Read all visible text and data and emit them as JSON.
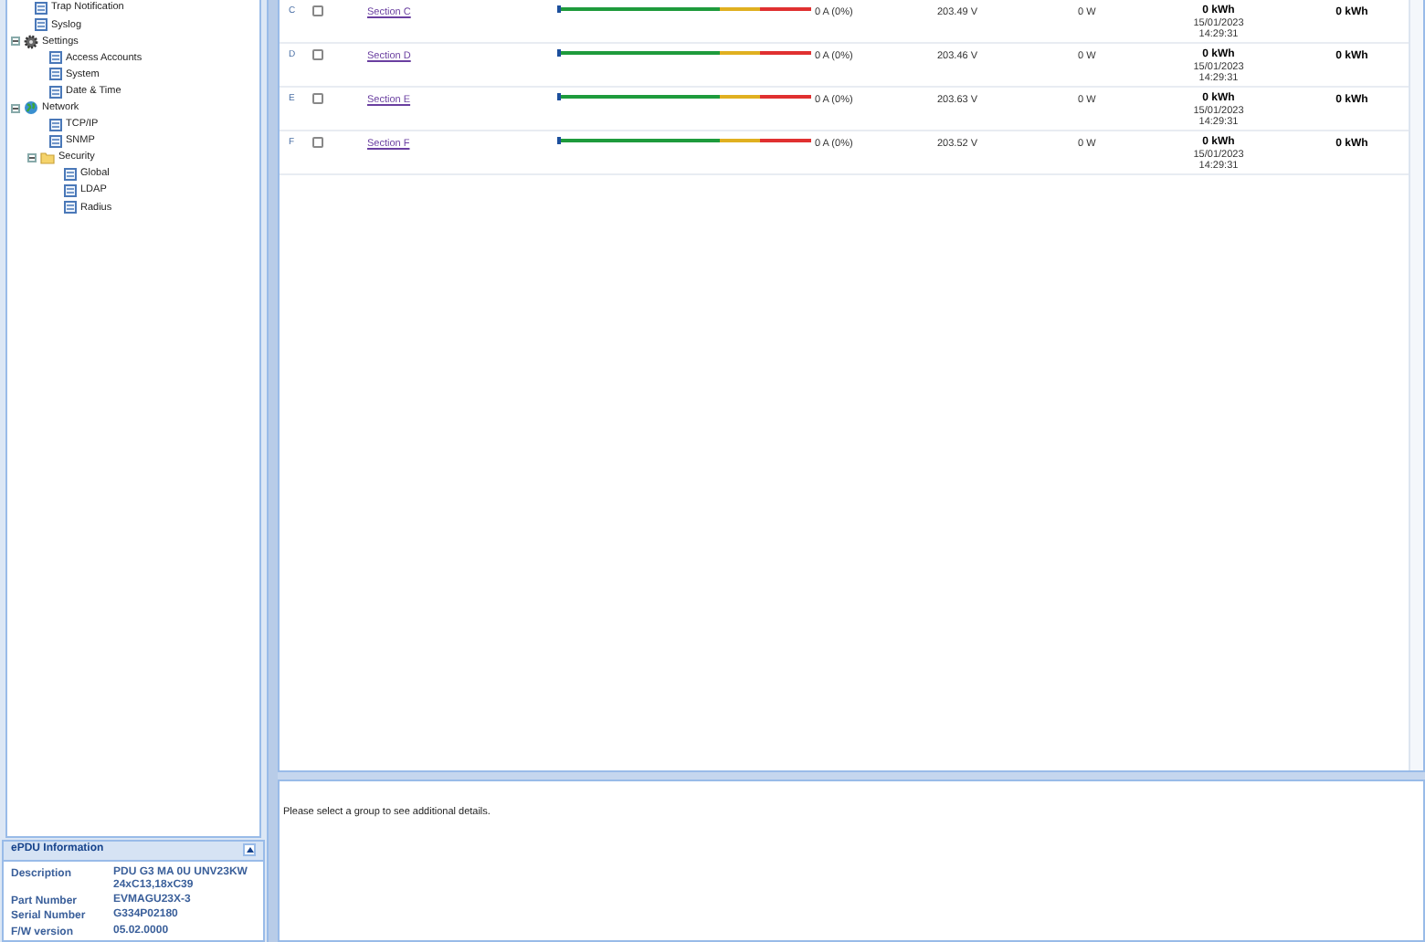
{
  "tree": [
    {
      "label": "Trap Notification",
      "kind": "page"
    },
    {
      "label": "Syslog",
      "kind": "page"
    },
    {
      "label": "Settings",
      "kind": "gear",
      "expanded": true,
      "children": [
        {
          "label": "Access Accounts",
          "kind": "page"
        },
        {
          "label": "System",
          "kind": "page"
        },
        {
          "label": "Date & Time",
          "kind": "page"
        }
      ]
    },
    {
      "label": "Network",
      "kind": "globe",
      "expanded": true,
      "children": [
        {
          "label": "TCP/IP",
          "kind": "page"
        },
        {
          "label": "SNMP",
          "kind": "page"
        },
        {
          "label": "Security",
          "kind": "folder",
          "expanded": true,
          "children": [
            {
              "label": "Global",
              "kind": "page"
            },
            {
              "label": "LDAP",
              "kind": "page"
            },
            {
              "label": "Radius",
              "kind": "page"
            }
          ]
        }
      ]
    }
  ],
  "info": {
    "title": "ePDU Information",
    "rows": [
      {
        "label": "Description",
        "value": [
          "PDU G3 MA 0U UNV23KW",
          "24xC13,18xC39"
        ]
      },
      {
        "label": "Part Number",
        "value": [
          "EVMAGU23X-3"
        ]
      },
      {
        "label": "Serial Number",
        "value": [
          "G334P02180"
        ]
      },
      {
        "label": "F/W version",
        "value": [
          "05.02.0000"
        ]
      }
    ]
  },
  "sections": [
    {
      "letter": "C",
      "checked": false,
      "name": "Section C",
      "level": 0,
      "current": "0 A (0%)",
      "voltage": "203.49 V",
      "power": "0 W",
      "energy": "0 kWh",
      "date": "15/01/2023",
      "time": "14:29:31",
      "total": "0 kWh"
    },
    {
      "letter": "D",
      "checked": false,
      "name": "Section D",
      "level": 0,
      "current": "0 A (0%)",
      "voltage": "203.46 V",
      "power": "0 W",
      "energy": "0 kWh",
      "date": "15/01/2023",
      "time": "14:29:31",
      "total": "0 kWh"
    },
    {
      "letter": "E",
      "checked": false,
      "name": "Section E",
      "level": 0,
      "current": "0 A (0%)",
      "voltage": "203.63 V",
      "power": "0 W",
      "energy": "0 kWh",
      "date": "15/01/2023",
      "time": "14:29:31",
      "total": "0 kWh"
    },
    {
      "letter": "F",
      "checked": false,
      "name": "Section F",
      "level": 0,
      "current": "0 A (0%)",
      "voltage": "203.52 V",
      "power": "0 W",
      "energy": "0 kWh",
      "date": "15/01/2023",
      "time": "14:29:31",
      "total": "0 kWh"
    }
  ],
  "detail": {
    "message": "Please select a group to see additional details."
  }
}
